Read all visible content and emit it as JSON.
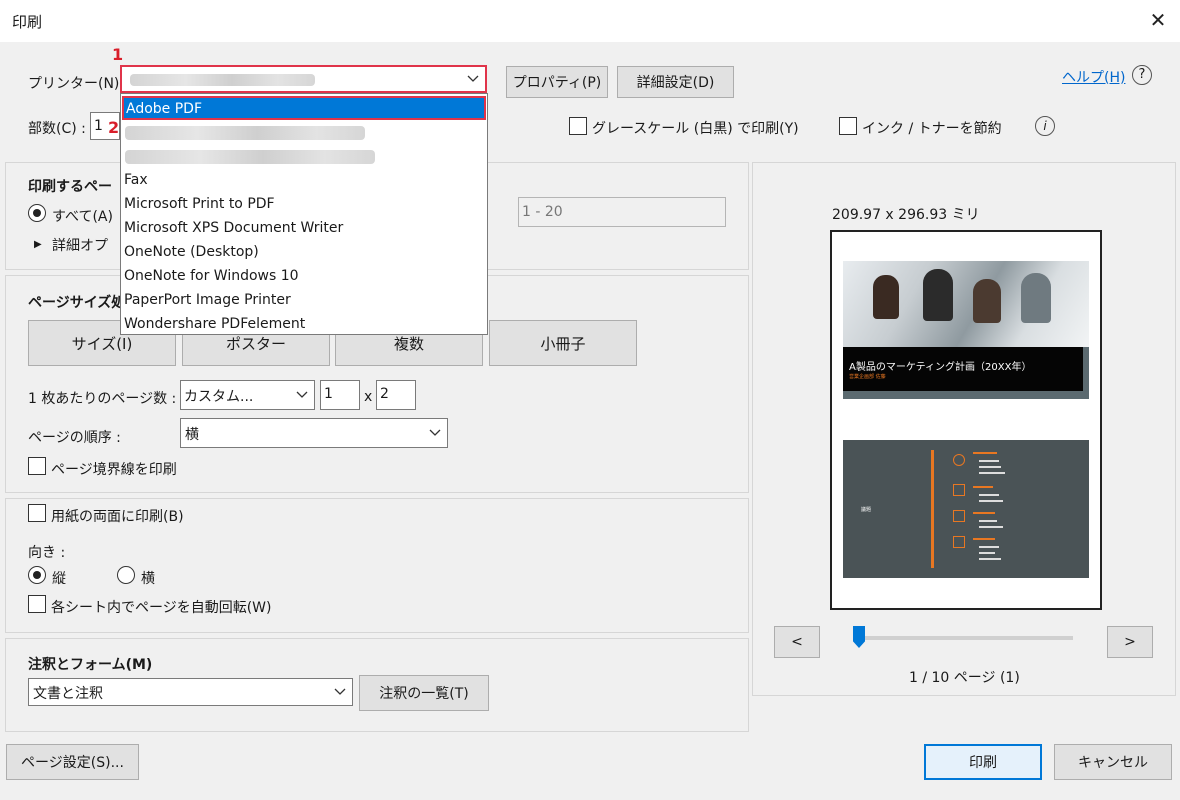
{
  "window": {
    "title": "印刷"
  },
  "printer": {
    "label": "プリンター(N) :",
    "properties_btn": "プロパティ(P)",
    "advanced_btn": "詳細設定(D)",
    "help_link": "ヘルプ(H)",
    "options": [
      "Adobe PDF",
      "Fax",
      "Microsoft Print to PDF",
      "Microsoft XPS Document Writer",
      "OneNote (Desktop)",
      "OneNote for Windows 10",
      "PaperPort Image Printer",
      "Wondershare PDFelement"
    ]
  },
  "markers": {
    "one": "1",
    "two": "2"
  },
  "copies": {
    "label": "部数(C) :",
    "value": "1"
  },
  "grayscale": {
    "label": "グレースケール (白黒) で印刷(Y)"
  },
  "save_ink": {
    "label": "インク / トナーを節約"
  },
  "pages": {
    "title": "印刷するペー",
    "all": "すべて(A)",
    "more_options": "詳細オプ",
    "range_value": "1 - 20"
  },
  "page_size": {
    "title": "ページサイズ処",
    "tabs": [
      "サイズ(I)",
      "ポスター",
      "複数",
      "小冊子"
    ],
    "pages_per_sheet_label": "1 枚あたりのページ数 :",
    "pages_per_sheet_value": "カスタム...",
    "cols": "1",
    "x": "x",
    "rows": "2",
    "order_label": "ページの順序 :",
    "order_value": "横",
    "border_label": "ページ境界線を印刷"
  },
  "duplex": {
    "label": "用紙の両面に印刷(B)",
    "orientation_label": "向き :",
    "portrait": "縦",
    "landscape": "横",
    "auto_rotate": "各シート内でページを自動回転(W)"
  },
  "comments": {
    "title": "注釈とフォーム(M)",
    "value": "文書と注釈",
    "summary_btn": "注釈の一覧(T)"
  },
  "preview": {
    "dimensions": "209.97 x 296.93 ミリ",
    "slide1_title": "A製品のマーケティング計画（20XX年）",
    "slide1_sub": "営業企画部 佐藤",
    "slide2_label": "議題",
    "prev": "<",
    "next": ">",
    "page_info": "1 / 10 ページ (1)",
    "slider_fraction": 0.0
  },
  "footer": {
    "page_setup_btn": "ページ設定(S)...",
    "print_btn": "印刷",
    "cancel_btn": "キャンセル"
  },
  "colors": {
    "accent": "#0078d7",
    "marker_red": "#d81e2a",
    "slide_orange": "#e87722",
    "slide_dark": "#4a5356"
  }
}
